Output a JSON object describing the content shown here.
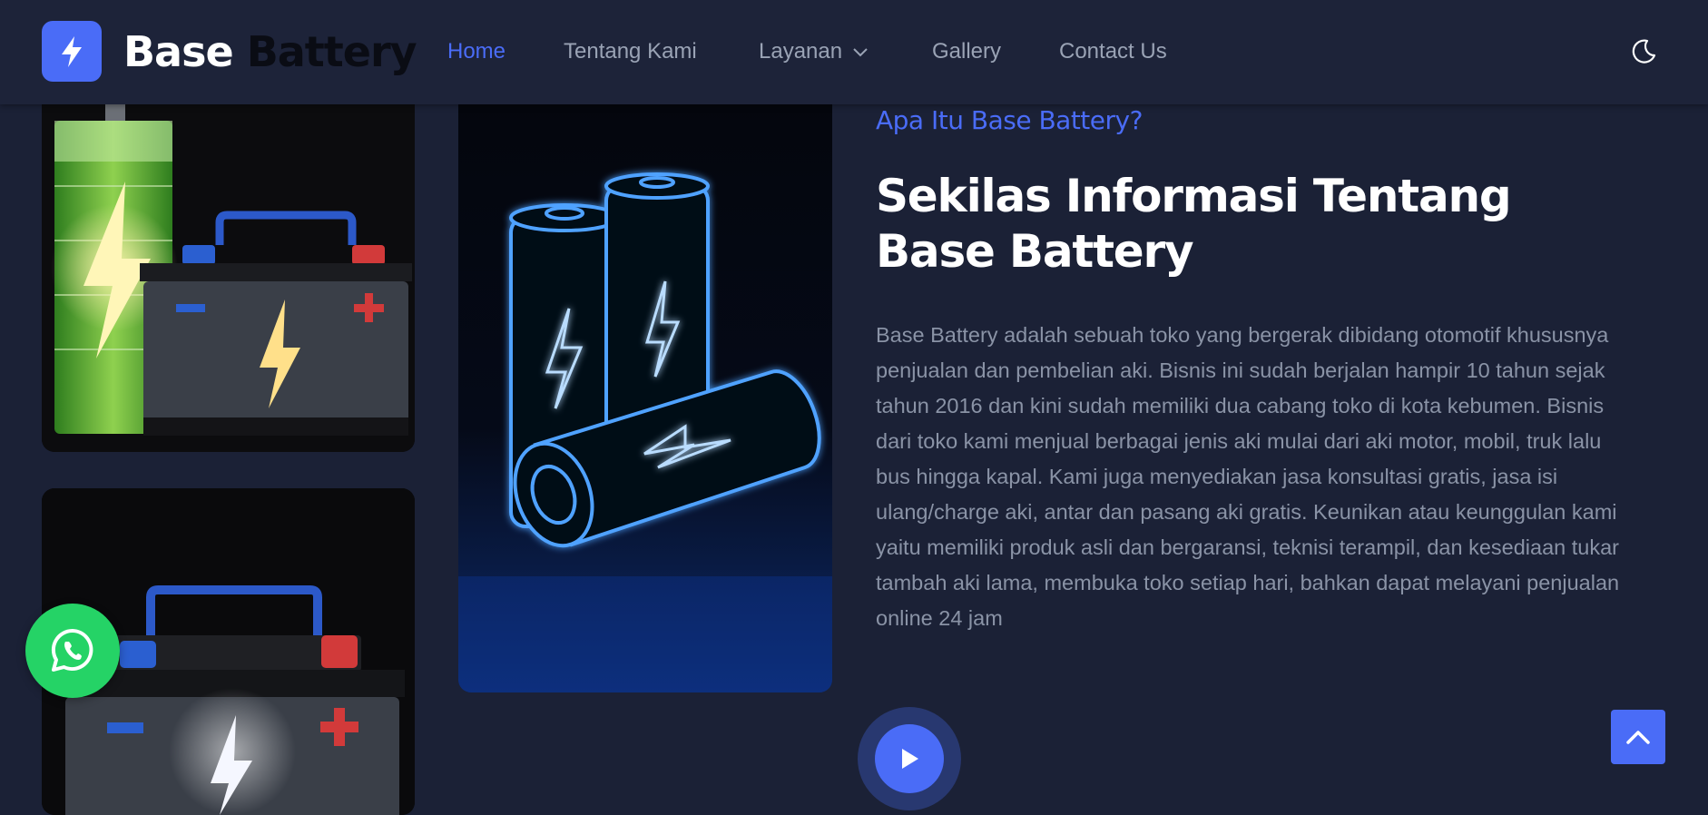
{
  "brand": {
    "word1": "Base",
    "word2": "Battery"
  },
  "nav": {
    "home": "Home",
    "about": "Tentang Kami",
    "services": "Layanan",
    "gallery": "Gallery",
    "contact": "Contact Us",
    "active": "home"
  },
  "icons": {
    "logo": "lightning-bolt-icon",
    "theme": "moon-icon",
    "dropdown": "chevron-down-icon",
    "play": "play-icon",
    "whatsapp": "whatsapp-icon",
    "scroll_top": "chevron-up-icon"
  },
  "about": {
    "eyebrow": "Apa Itu Base Battery?",
    "heading": "Sekilas Informasi Tentang Base Battery",
    "paragraph": "Base Battery adalah sebuah toko yang bergerak dibidang otomotif khususnya penjualan dan pembelian aki. Bisnis ini sudah berjalan hampir 10 tahun sejak tahun 2016 dan kini sudah memiliki dua cabang toko di kota kebumen. Bisnis dari toko kami menjual berbagai jenis aki mulai dari aki motor, mobil, truk lalu bus hingga kapal. Kami juga menyediakan jasa konsultasi gratis, jasa isi ulang/charge aki, antar dan pasang aki gratis. Keunikan atau keunggulan kami yaitu memiliki produk asli dan bergaransi, teknisi terampil, dan kesediaan tukar tambah aki lama, membuka toko setiap hari, bahkan dapat melayani penjualan online 24 jam"
  },
  "colors": {
    "background": "#1b2136",
    "header": "#1d2339",
    "accent": "#4a6cf7",
    "text_muted": "#8a93a6",
    "whatsapp": "#25d366"
  }
}
